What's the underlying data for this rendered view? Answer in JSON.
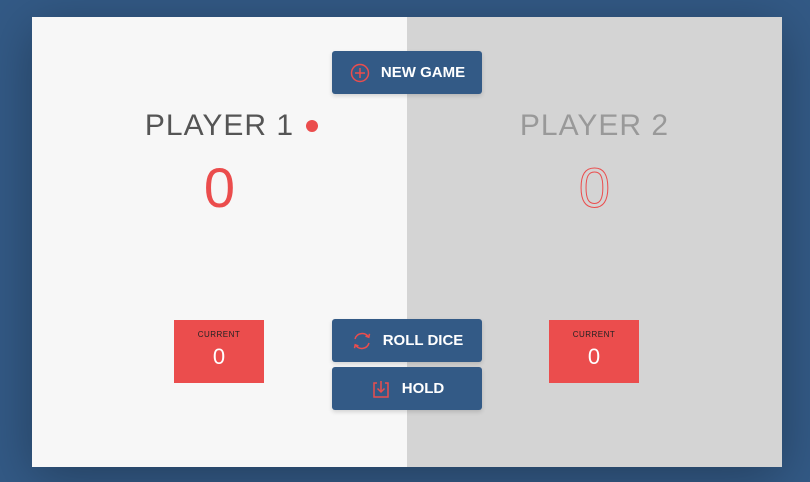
{
  "colors": {
    "background": "#335a86",
    "active_panel": "#f7f7f7",
    "inactive_panel": "#d4d4d4",
    "accent": "#eb4d4d",
    "button": "#335a86"
  },
  "buttons": {
    "new_game": {
      "label": "NEW GAME",
      "icon": "plus-circle-icon"
    },
    "roll_dice": {
      "label": "ROLL DICE",
      "icon": "refresh-icon"
    },
    "hold": {
      "label": "HOLD",
      "icon": "download-icon"
    }
  },
  "players": [
    {
      "name": "PLAYER 1",
      "score": "0",
      "current_label": "CURRENT",
      "current_value": "0",
      "active": true
    },
    {
      "name": "PLAYER 2",
      "score": "0",
      "current_label": "CURRENT",
      "current_value": "0",
      "active": false
    }
  ]
}
